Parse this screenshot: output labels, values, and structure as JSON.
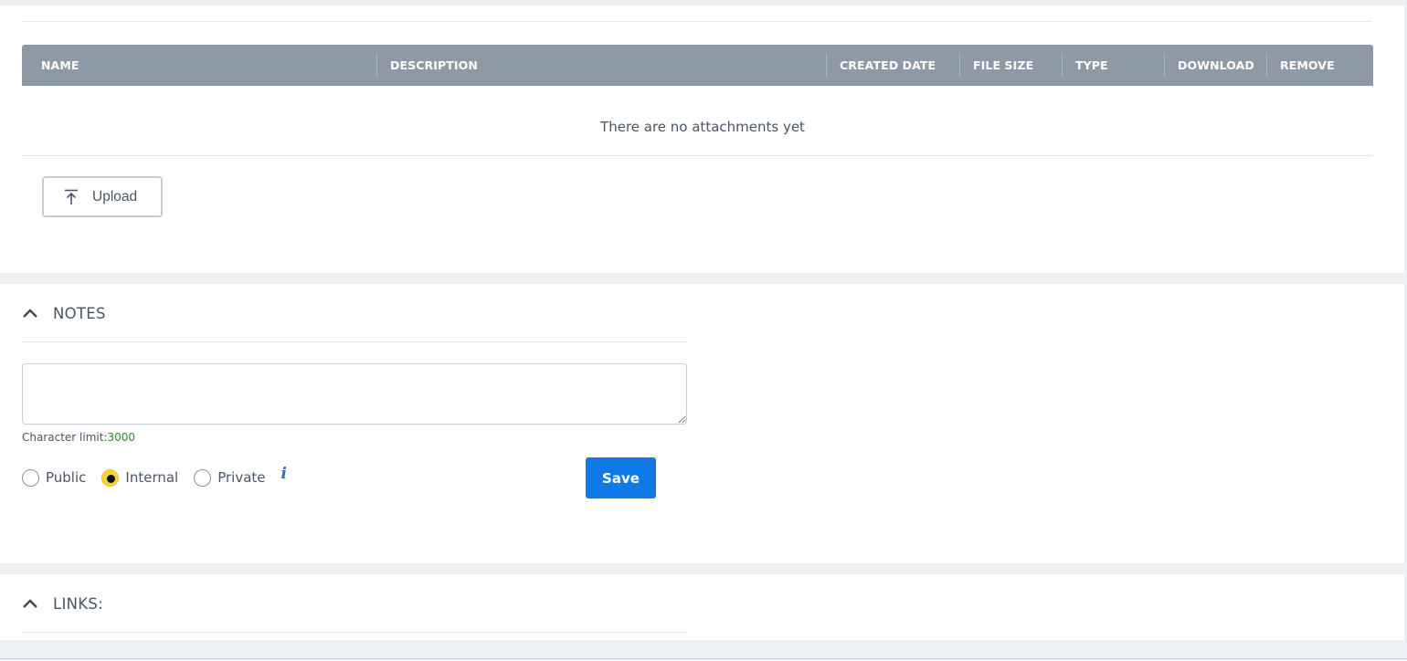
{
  "attachments": {
    "columns": [
      "NAME",
      "DESCRIPTION",
      "CREATED DATE",
      "FILE SIZE",
      "TYPE",
      "DOWNLOAD",
      "REMOVE"
    ],
    "empty_message": "There are no attachments yet",
    "upload_label": "Upload",
    "upload_icon": "upload-arrow-icon"
  },
  "notes": {
    "title": "NOTES",
    "toggle_icon": "chevron-up-icon",
    "textarea_value": "",
    "char_limit_label": "Character limit:",
    "char_limit_value": "3000",
    "char_limit_color": "#2e8b2e",
    "visibility_options": [
      "Public",
      "Internal",
      "Private"
    ],
    "visibility_selected": "Internal",
    "info_icon": "info-icon",
    "save_label": "Save"
  },
  "links": {
    "title": "LINKS:",
    "toggle_icon": "chevron-up-icon"
  },
  "colors": {
    "table_header_bg": "#8d9aa6",
    "primary_button": "#0f7ae5",
    "radio_selected": "#f6d33b",
    "info_icon": "#1a74c9"
  }
}
